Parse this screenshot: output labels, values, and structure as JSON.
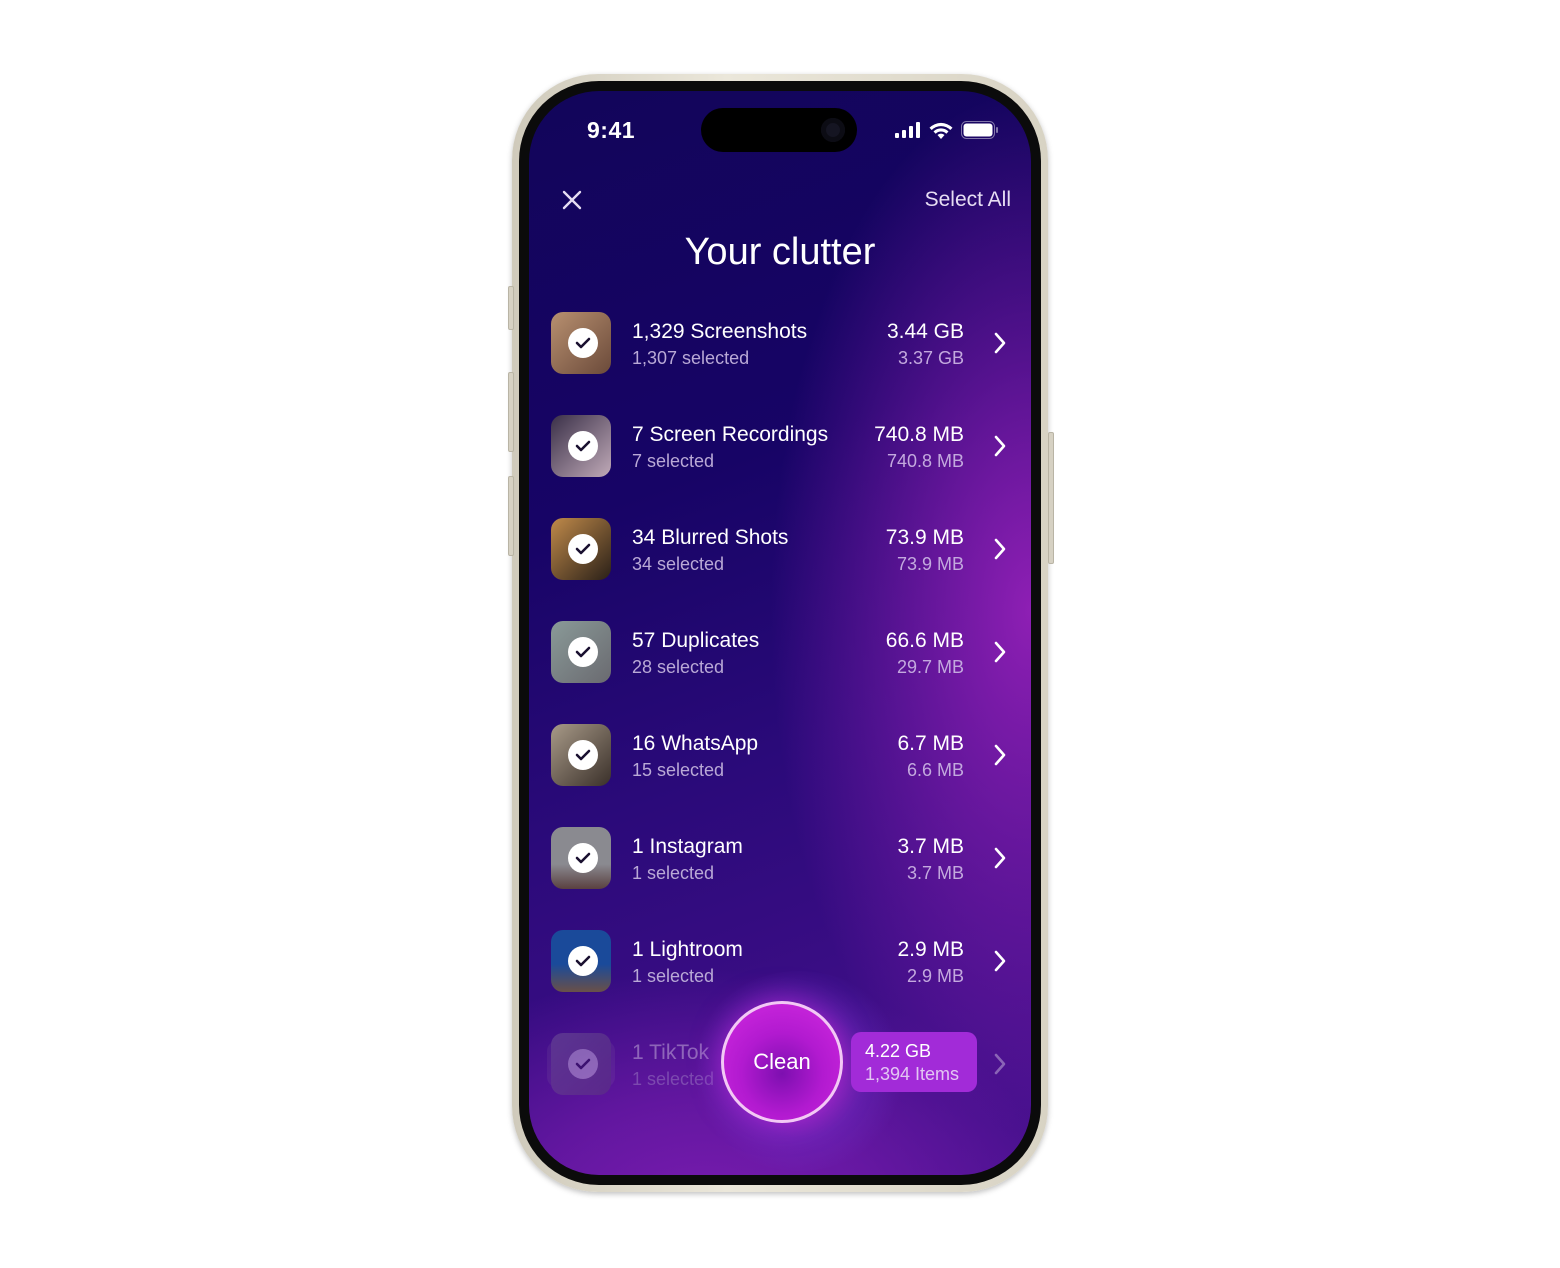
{
  "status_bar": {
    "time": "9:41",
    "icons": [
      "signal-icon",
      "wifi-icon",
      "battery-icon"
    ]
  },
  "header": {
    "close_icon": "close-icon",
    "select_all_label": "Select All",
    "title": "Your clutter"
  },
  "items": [
    {
      "name": "1,329 Screenshots",
      "selected": "1,307 selected",
      "total_size": "3.44 GB",
      "selected_size": "3.37 GB"
    },
    {
      "name": "7 Screen Recordings",
      "selected": "7 selected",
      "total_size": "740.8 MB",
      "selected_size": "740.8 MB"
    },
    {
      "name": "34 Blurred Shots",
      "selected": "34 selected",
      "total_size": "73.9 MB",
      "selected_size": "73.9 MB"
    },
    {
      "name": "57 Duplicates",
      "selected": "28 selected",
      "total_size": "66.6 MB",
      "selected_size": "29.7 MB"
    },
    {
      "name": "16 WhatsApp",
      "selected": "15 selected",
      "total_size": "6.7 MB",
      "selected_size": "6.6 MB"
    },
    {
      "name": "1 Instagram",
      "selected": "1 selected",
      "total_size": "3.7 MB",
      "selected_size": "3.7 MB"
    },
    {
      "name": "1 Lightroom",
      "selected": "1 selected",
      "total_size": "2.9 MB",
      "selected_size": "2.9 MB"
    },
    {
      "name": "1 TikTok",
      "selected": "1 selected",
      "total_size": "",
      "selected_size": ""
    }
  ],
  "footer": {
    "clean_label": "Clean",
    "summary_size": "4.22 GB",
    "summary_items": "1,394 Items"
  },
  "colors": {
    "accent": "#a22bd8",
    "background_dark": "#12055a",
    "background_purple": "#8e1fb4"
  }
}
